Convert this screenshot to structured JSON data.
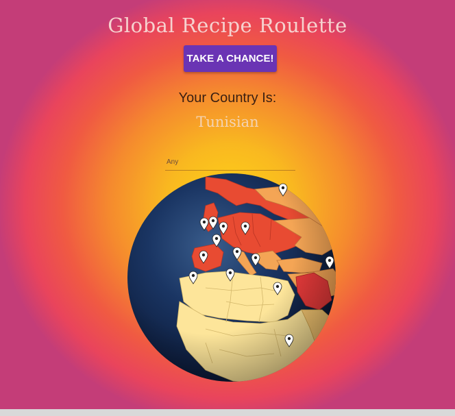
{
  "header": {
    "title": "Global Recipe Roulette"
  },
  "actions": {
    "chance_label": "TAKE A CHANCE!"
  },
  "result": {
    "label": "Your Country Is:",
    "country": "Tunisian"
  },
  "filter": {
    "value": "Any"
  },
  "globe": {
    "pin_count": 16,
    "colors": {
      "ocean": "#0d1f3f",
      "dark_land": "#e84b32",
      "mid_land": "#f4a555",
      "light_land": "#fde59a",
      "highlight": "#e63a3a",
      "pin": "#ffffff"
    }
  }
}
